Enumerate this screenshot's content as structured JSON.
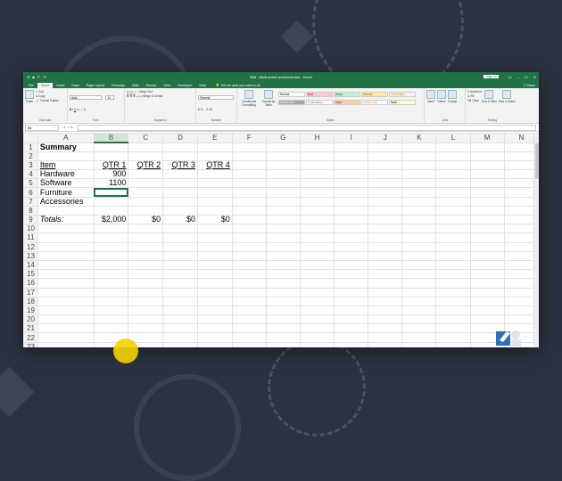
{
  "window": {
    "title": "Bk8 - Multi-sheet workbook.xlsx - Excel",
    "signin_label": "Sign in",
    "share_label": "Share"
  },
  "tabs": [
    "File",
    "Home",
    "Insert",
    "Draw",
    "Page Layout",
    "Formulas",
    "Data",
    "Review",
    "View",
    "Developer",
    "Help"
  ],
  "tell_me": "Tell me what you want to do",
  "ribbon": {
    "clipboard": {
      "label": "Clipboard",
      "paste": "Paste",
      "cut": "Cut",
      "copy": "Copy",
      "format_painter": "Format Painter"
    },
    "font": {
      "label": "Font",
      "name": "Arial",
      "size": "10"
    },
    "alignment": {
      "label": "Alignment",
      "wrap": "Wrap Text",
      "merge": "Merge & Center"
    },
    "number": {
      "label": "Number",
      "format": "General"
    },
    "styles": {
      "label": "Styles",
      "conditional": "Conditional Formatting",
      "format_table": "Format as Table",
      "cells": [
        {
          "text": "Normal",
          "bg": "#ffffff",
          "fg": "#000000"
        },
        {
          "text": "Bad",
          "bg": "#ffc7ce",
          "fg": "#9c0006"
        },
        {
          "text": "Good",
          "bg": "#c6efce",
          "fg": "#006100"
        },
        {
          "text": "Neutral",
          "bg": "#ffeb9c",
          "fg": "#9c5700"
        },
        {
          "text": "Calculation",
          "bg": "#f2f2f2",
          "fg": "#fa7d00"
        },
        {
          "text": "Check Cell",
          "bg": "#a5a5a5",
          "fg": "#ffffff"
        },
        {
          "text": "Explanatory ...",
          "bg": "#ffffff",
          "fg": "#7f7f7f"
        },
        {
          "text": "Input",
          "bg": "#ffcc99",
          "fg": "#3f3f76"
        },
        {
          "text": "Linked Cell",
          "bg": "#ffffff",
          "fg": "#fa7d00"
        },
        {
          "text": "Note",
          "bg": "#ffffcc",
          "fg": "#000000"
        }
      ]
    },
    "cells": {
      "label": "Cells",
      "insert": "Insert",
      "delete": "Delete",
      "format": "Format"
    },
    "editing": {
      "label": "Editing",
      "autosum": "AutoSum",
      "fill": "Fill",
      "clear": "Clear",
      "sort": "Sort & Filter",
      "find": "Find & Select"
    }
  },
  "formula_bar": {
    "name_box": "B6",
    "fx": "fx",
    "value": ""
  },
  "sheet": {
    "columns": [
      "A",
      "B",
      "C",
      "D",
      "E",
      "F",
      "G",
      "H",
      "I",
      "J",
      "K",
      "L",
      "M",
      "N"
    ],
    "selected_column": "B",
    "rows": [
      [
        "Summary",
        "",
        "",
        "",
        "",
        "",
        "",
        "",
        "",
        "",
        "",
        "",
        "",
        ""
      ],
      [
        "",
        "",
        "",
        "",
        "",
        "",
        "",
        "",
        "",
        "",
        "",
        "",
        "",
        ""
      ],
      [
        "Item",
        "QTR 1",
        "QTR 2",
        "QTR 3",
        "QTR 4",
        "",
        "",
        "",
        "",
        "",
        "",
        "",
        "",
        ""
      ],
      [
        "Hardware",
        "900",
        "",
        "",
        "",
        "",
        "",
        "",
        "",
        "",
        "",
        "",
        "",
        ""
      ],
      [
        "Software",
        "1100",
        "",
        "",
        "",
        "",
        "",
        "",
        "",
        "",
        "",
        "",
        "",
        ""
      ],
      [
        "Furniture",
        "",
        "",
        "",
        "",
        "",
        "",
        "",
        "",
        "",
        "",
        "",
        "",
        ""
      ],
      [
        "Accessories",
        "",
        "",
        "",
        "",
        "",
        "",
        "",
        "",
        "",
        "",
        "",
        "",
        ""
      ],
      [
        "",
        "",
        "",
        "",
        "",
        "",
        "",
        "",
        "",
        "",
        "",
        "",
        "",
        ""
      ],
      [
        "Totals:",
        "$2,000",
        "$0",
        "$0",
        "$0",
        "",
        "",
        "",
        "",
        "",
        "",
        "",
        "",
        ""
      ],
      [
        "",
        "",
        "",
        "",
        "",
        "",
        "",
        "",
        "",
        "",
        "",
        "",
        "",
        ""
      ],
      [
        "",
        "",
        "",
        "",
        "",
        "",
        "",
        "",
        "",
        "",
        "",
        "",
        "",
        ""
      ],
      [
        "",
        "",
        "",
        "",
        "",
        "",
        "",
        "",
        "",
        "",
        "",
        "",
        "",
        ""
      ],
      [
        "",
        "",
        "",
        "",
        "",
        "",
        "",
        "",
        "",
        "",
        "",
        "",
        "",
        ""
      ],
      [
        "",
        "",
        "",
        "",
        "",
        "",
        "",
        "",
        "",
        "",
        "",
        "",
        "",
        ""
      ],
      [
        "",
        "",
        "",
        "",
        "",
        "",
        "",
        "",
        "",
        "",
        "",
        "",
        "",
        ""
      ],
      [
        "",
        "",
        "",
        "",
        "",
        "",
        "",
        "",
        "",
        "",
        "",
        "",
        "",
        ""
      ],
      [
        "",
        "",
        "",
        "",
        "",
        "",
        "",
        "",
        "",
        "",
        "",
        "",
        "",
        ""
      ],
      [
        "",
        "",
        "",
        "",
        "",
        "",
        "",
        "",
        "",
        "",
        "",
        "",
        "",
        ""
      ],
      [
        "",
        "",
        "",
        "",
        "",
        "",
        "",
        "",
        "",
        "",
        "",
        "",
        "",
        ""
      ],
      [
        "",
        "",
        "",
        "",
        "",
        "",
        "",
        "",
        "",
        "",
        "",
        "",
        "",
        ""
      ],
      [
        "",
        "",
        "",
        "",
        "",
        "",
        "",
        "",
        "",
        "",
        "",
        "",
        "",
        ""
      ],
      [
        "",
        "",
        "",
        "",
        "",
        "",
        "",
        "",
        "",
        "",
        "",
        "",
        "",
        ""
      ],
      [
        "",
        "",
        "",
        "",
        "",
        "",
        "",
        "",
        "",
        "",
        "",
        "",
        "",
        ""
      ]
    ]
  },
  "colors": {
    "excel_green": "#217346",
    "background": "#2c3340",
    "cursor_highlight": "#f5d100"
  }
}
